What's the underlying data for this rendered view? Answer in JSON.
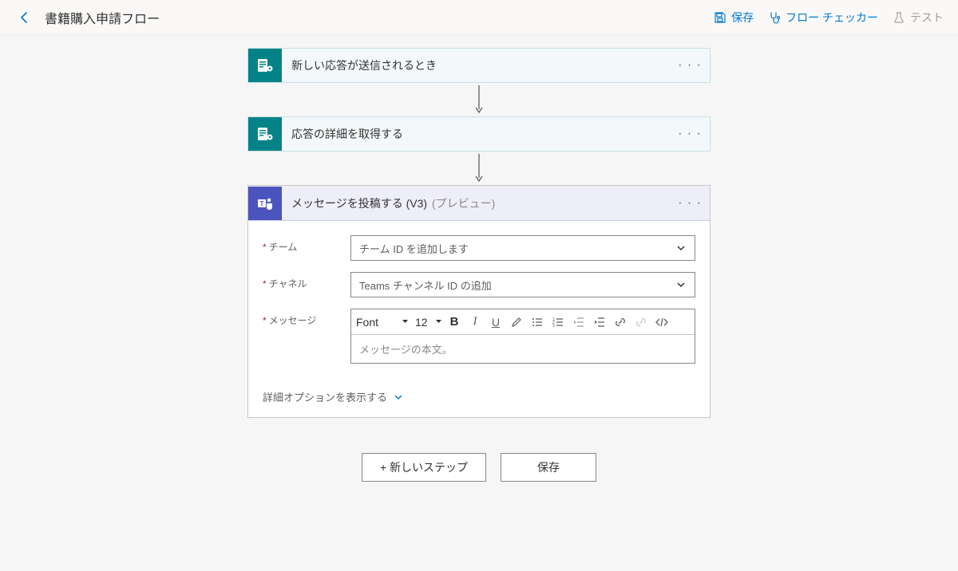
{
  "header": {
    "title": "書籍購入申請フロー",
    "save": "保存",
    "flow_checker": "フロー チェッカー",
    "test": "テスト"
  },
  "steps": {
    "trigger": {
      "title": "新しい応答が送信されるとき"
    },
    "getDetails": {
      "title": "応答の詳細を取得する"
    },
    "postMessage": {
      "title": "メッセージを投稿する (V3)",
      "preview_suffix": "(プレビュー)",
      "fields": {
        "team": {
          "label": "チーム",
          "placeholder": "チーム ID を追加します"
        },
        "channel": {
          "label": "チャネル",
          "placeholder": "Teams チャンネル ID の追加"
        },
        "message": {
          "label": "メッセージ",
          "placeholder": "メッセージの本文。"
        }
      },
      "rte": {
        "font": "Font",
        "size": "12"
      },
      "advanced": "詳細オプションを表示する"
    }
  },
  "bottom": {
    "new_step": "+ 新しいステップ",
    "save": "保存"
  }
}
